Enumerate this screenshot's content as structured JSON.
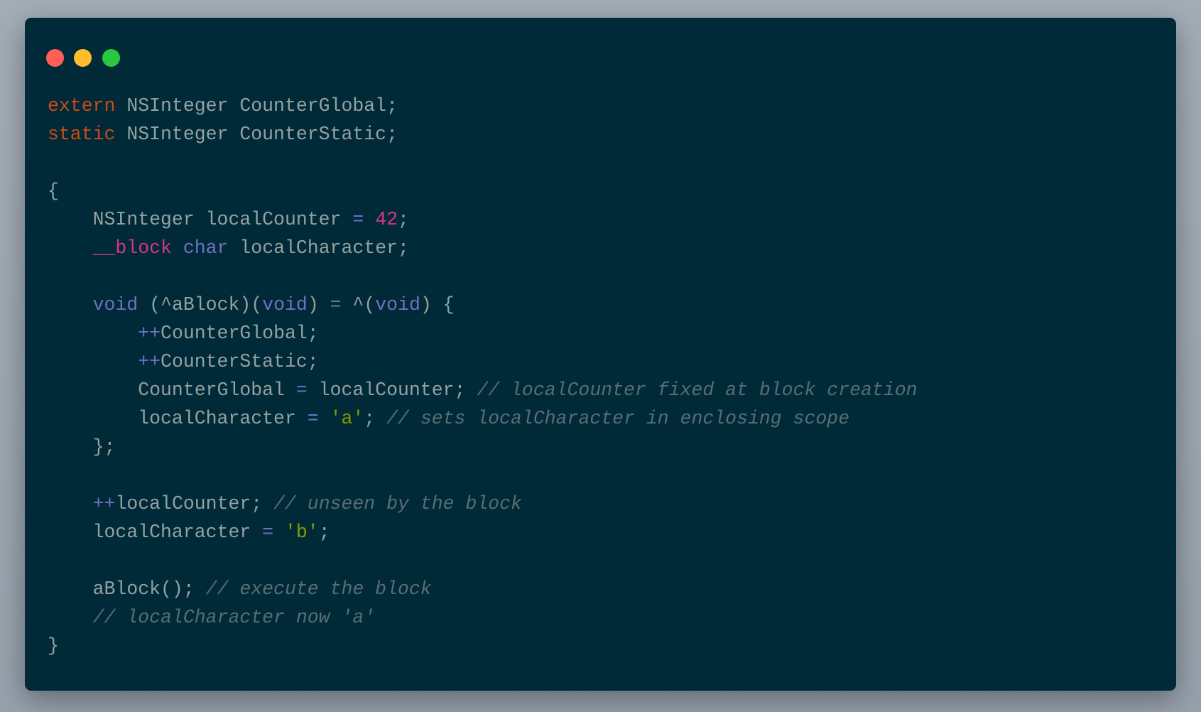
{
  "window": {
    "controls": [
      "close",
      "minimize",
      "zoom"
    ],
    "colors": {
      "background": "#002a37",
      "close": "#ff5f57",
      "minimize": "#ffbd2e",
      "zoom": "#28c840"
    }
  },
  "syntax_colors": {
    "kw": "#cb4b16",
    "mag": "#d33682",
    "vio": "#6c71c4",
    "str": "#859900",
    "com": "#586e75",
    "plain": "#93a1a1"
  },
  "code": {
    "lines": [
      [
        [
          "kw",
          "extern"
        ],
        [
          "plain",
          " NSInteger CounterGlobal;"
        ]
      ],
      [
        [
          "kw",
          "static"
        ],
        [
          "plain",
          " NSInteger CounterStatic;"
        ]
      ],
      [],
      [
        [
          "plain",
          "{"
        ]
      ],
      [
        [
          "plain",
          "    NSInteger localCounter "
        ],
        [
          "vio",
          "="
        ],
        [
          "plain",
          " "
        ],
        [
          "mag",
          "42"
        ],
        [
          "plain",
          ";"
        ]
      ],
      [
        [
          "plain",
          "    "
        ],
        [
          "mag",
          "__block"
        ],
        [
          "plain",
          " "
        ],
        [
          "vio",
          "char"
        ],
        [
          "plain",
          " localCharacter;"
        ]
      ],
      [],
      [
        [
          "plain",
          "    "
        ],
        [
          "vio",
          "void"
        ],
        [
          "plain",
          " (^aBlock)("
        ],
        [
          "vio",
          "void"
        ],
        [
          "plain",
          ") "
        ],
        [
          "vio",
          "="
        ],
        [
          "plain",
          " ^("
        ],
        [
          "vio",
          "void"
        ],
        [
          "plain",
          ") {"
        ]
      ],
      [
        [
          "plain",
          "        "
        ],
        [
          "vio",
          "++"
        ],
        [
          "plain",
          "CounterGlobal;"
        ]
      ],
      [
        [
          "plain",
          "        "
        ],
        [
          "vio",
          "++"
        ],
        [
          "plain",
          "CounterStatic;"
        ]
      ],
      [
        [
          "plain",
          "        CounterGlobal "
        ],
        [
          "vio",
          "="
        ],
        [
          "plain",
          " localCounter; "
        ],
        [
          "com",
          "// localCounter fixed at block creation"
        ]
      ],
      [
        [
          "plain",
          "        localCharacter "
        ],
        [
          "vio",
          "="
        ],
        [
          "plain",
          " "
        ],
        [
          "str",
          "'a'"
        ],
        [
          "plain",
          "; "
        ],
        [
          "com",
          "// sets localCharacter in enclosing scope"
        ]
      ],
      [
        [
          "plain",
          "    };"
        ]
      ],
      [],
      [
        [
          "plain",
          "    "
        ],
        [
          "vio",
          "++"
        ],
        [
          "plain",
          "localCounter; "
        ],
        [
          "com",
          "// unseen by the block"
        ]
      ],
      [
        [
          "plain",
          "    localCharacter "
        ],
        [
          "vio",
          "="
        ],
        [
          "plain",
          " "
        ],
        [
          "str",
          "'b'"
        ],
        [
          "plain",
          ";"
        ]
      ],
      [],
      [
        [
          "plain",
          "    aBlock(); "
        ],
        [
          "com",
          "// execute the block"
        ]
      ],
      [
        [
          "plain",
          "    "
        ],
        [
          "com",
          "// localCharacter now 'a'"
        ]
      ],
      [
        [
          "plain",
          "}"
        ]
      ]
    ]
  }
}
